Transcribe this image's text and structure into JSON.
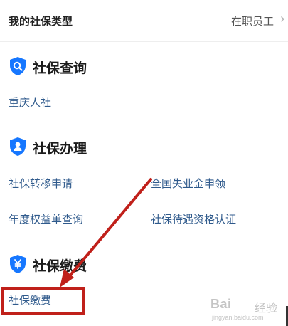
{
  "header": {
    "title": "我的社保类型",
    "value": "在职员工"
  },
  "sections": [
    {
      "title": "社保查询",
      "icon": "search-icon",
      "links": [
        "重庆人社"
      ]
    },
    {
      "title": "社保办理",
      "icon": "person-icon",
      "links": [
        "社保转移申请",
        "全国失业金申领",
        "年度权益单查询",
        "社保待遇资格认证"
      ]
    },
    {
      "title": "社保缴费",
      "icon": "yuan-icon",
      "links": [
        "社保缴费"
      ]
    }
  ],
  "colors": {
    "accent": "#1677ff",
    "link": "#2f5a8c",
    "annotation": "#c0201a"
  },
  "watermark": {
    "brand": "Bai",
    "brand2": "经验",
    "url": "jingyan.baidu.com"
  }
}
